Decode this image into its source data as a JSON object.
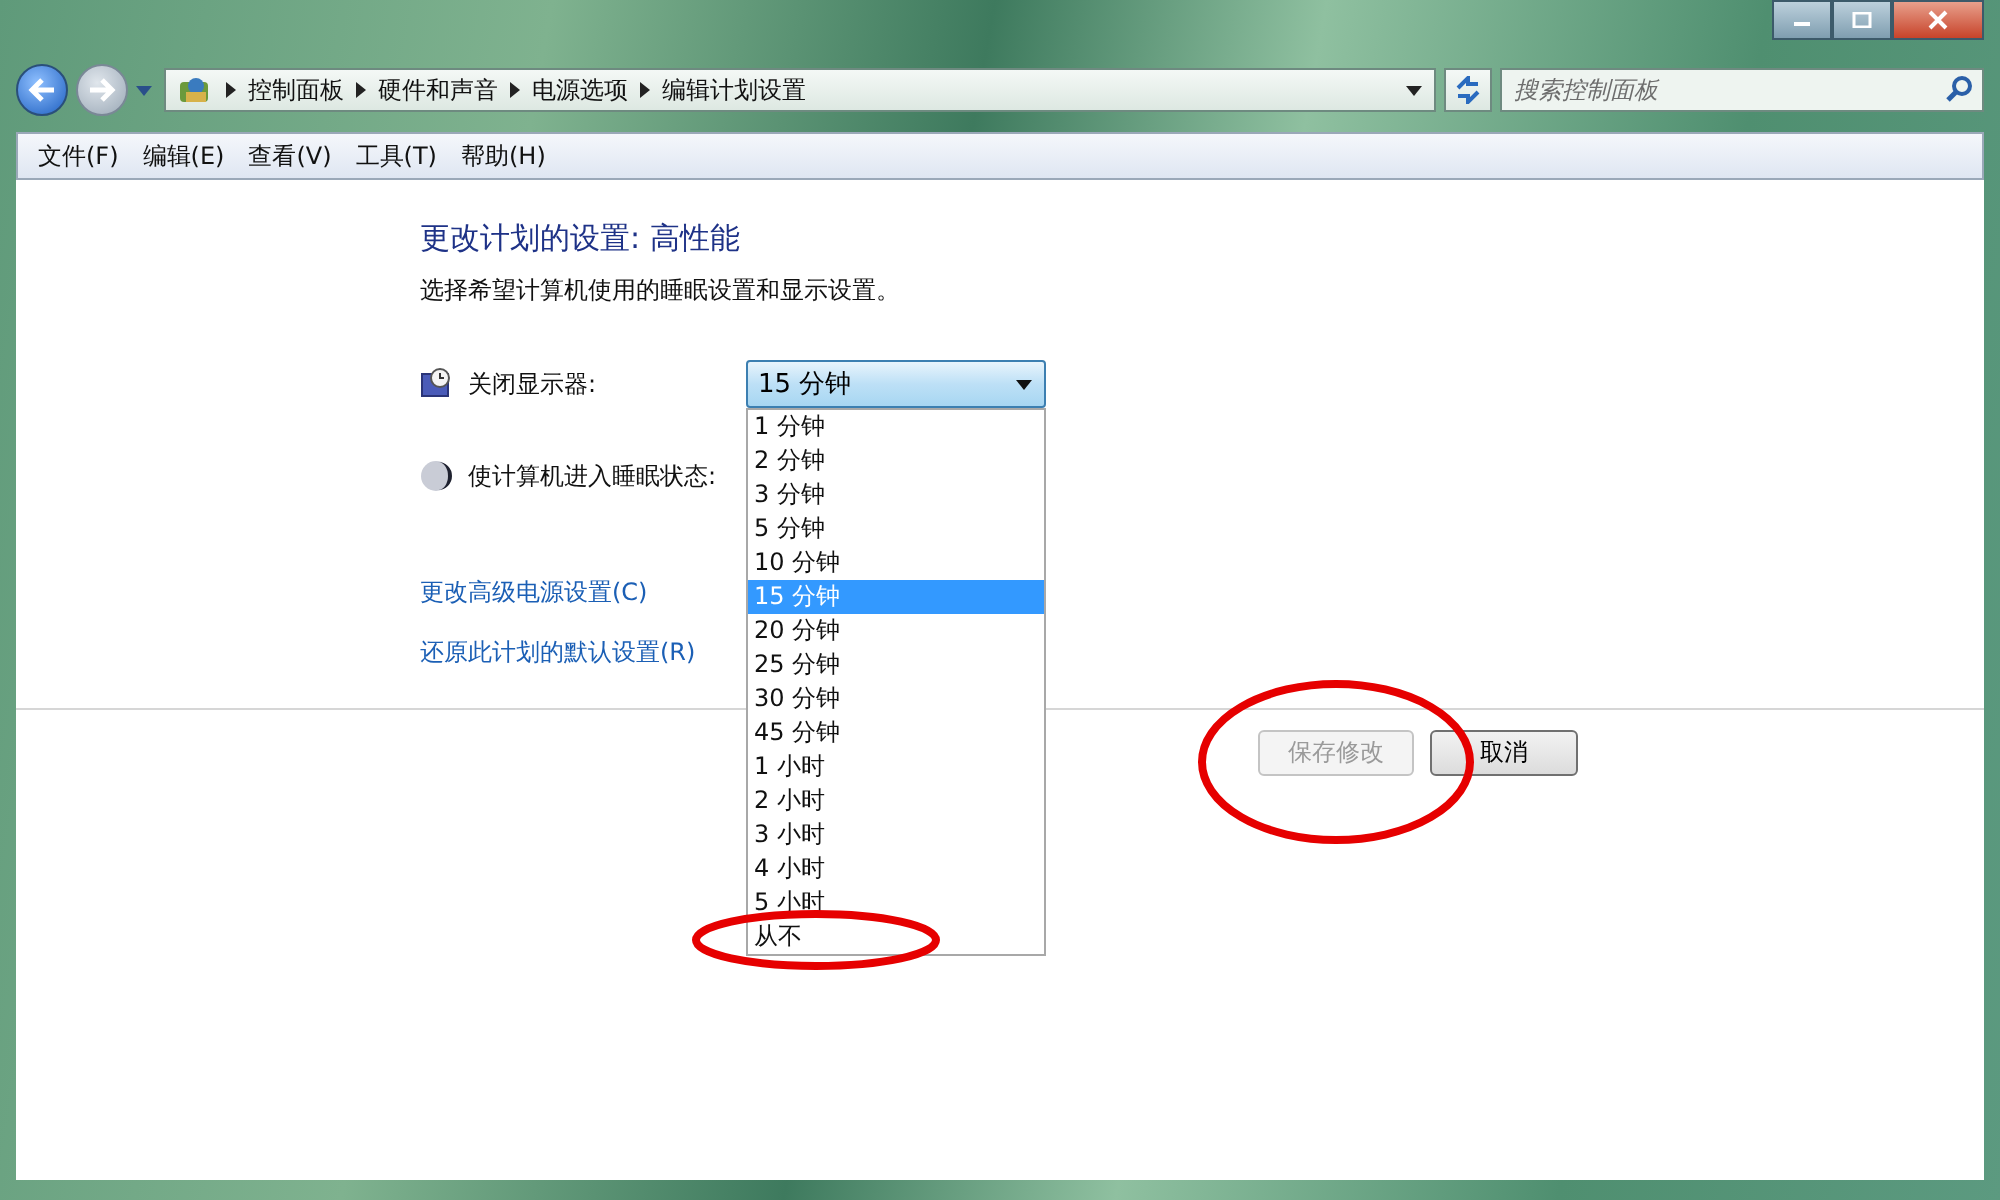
{
  "address_bar": {
    "breadcrumbs": [
      "控制面板",
      "硬件和声音",
      "电源选项",
      "编辑计划设置"
    ]
  },
  "search": {
    "placeholder": "搜索控制面板"
  },
  "menu": [
    "文件(F)",
    "编辑(E)",
    "查看(V)",
    "工具(T)",
    "帮助(H)"
  ],
  "heading": "更改计划的设置: 高性能",
  "description": "选择希望计算机使用的睡眠设置和显示设置。",
  "settings": [
    {
      "kind": "display",
      "label": "关闭显示器:",
      "value": "15 分钟",
      "expanded": true
    },
    {
      "kind": "sleep",
      "label": "使计算机进入睡眠状态:"
    }
  ],
  "dropdown_options": [
    {
      "label": "1 分钟",
      "selected": false
    },
    {
      "label": "2 分钟",
      "selected": false
    },
    {
      "label": "3 分钟",
      "selected": false
    },
    {
      "label": "5 分钟",
      "selected": false
    },
    {
      "label": "10 分钟",
      "selected": false
    },
    {
      "label": "15 分钟",
      "selected": true
    },
    {
      "label": "20 分钟",
      "selected": false
    },
    {
      "label": "25 分钟",
      "selected": false
    },
    {
      "label": "30 分钟",
      "selected": false
    },
    {
      "label": "45 分钟",
      "selected": false
    },
    {
      "label": "1 小时",
      "selected": false
    },
    {
      "label": "2 小时",
      "selected": false
    },
    {
      "label": "3 小时",
      "selected": false
    },
    {
      "label": "4 小时",
      "selected": false
    },
    {
      "label": "5 小时",
      "selected": false
    },
    {
      "label": "从不",
      "selected": false
    }
  ],
  "links": [
    "更改高级电源设置(C)",
    "还原此计划的默认设置(R)"
  ],
  "buttons": [
    {
      "label": "保存修改",
      "disabled": true
    },
    {
      "label": "取消",
      "disabled": false
    }
  ]
}
